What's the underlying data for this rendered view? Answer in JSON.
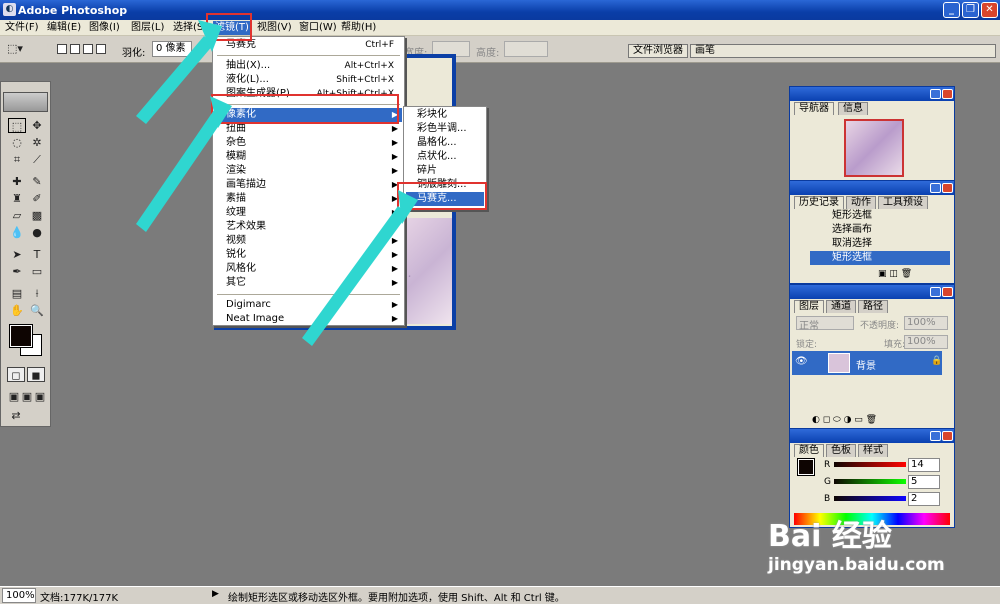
{
  "window": {
    "title": "Adobe Photoshop"
  },
  "menubar": {
    "items": [
      "文件(F)",
      "编辑(E)",
      "图像(I)",
      "图层(L)",
      "选择(S)",
      "滤镜(T)",
      "视图(V)",
      "窗口(W)",
      "帮助(H)"
    ]
  },
  "options": {
    "feather_label": "羽化:",
    "feather_value": "0 像素",
    "width_label": "宽度:",
    "height_label": "高度:",
    "well_tabs": [
      "文件浏览器",
      "画笔"
    ]
  },
  "filter_menu": {
    "last_filter": "马赛克",
    "last_filter_shortcut": "Ctrl+F",
    "items": [
      {
        "label": "抽出(X)...",
        "shortcut": "Alt+Ctrl+X"
      },
      {
        "label": "液化(L)...",
        "shortcut": "Shift+Ctrl+X"
      },
      {
        "label": "图案生成器(P)...",
        "shortcut": "Alt+Shift+Ctrl+X"
      }
    ],
    "submenus": [
      "像素化",
      "扭曲",
      "杂色",
      "模糊",
      "渲染",
      "画笔描边",
      "素描",
      "纹理",
      "艺术效果",
      "视频",
      "锐化",
      "风格化",
      "其它"
    ],
    "plugins": [
      "Digimarc",
      "Neat Image"
    ]
  },
  "pixelate_menu": {
    "items": [
      "彩块化",
      "彩色半调...",
      "晶格化...",
      "点状化...",
      "碎片",
      "铜版雕刻...",
      "马赛克..."
    ]
  },
  "navigator_panel": {
    "tabs": [
      "导航器",
      "信息"
    ]
  },
  "history_panel": {
    "tabs": [
      "历史记录",
      "动作",
      "工具预设"
    ],
    "rows": [
      "矩形选框",
      "选择画布",
      "取消选择",
      "矩形选框"
    ]
  },
  "layers_panel": {
    "tabs": [
      "图层",
      "通道",
      "路径"
    ],
    "blend_mode": "正常",
    "opacity_label": "不透明度:",
    "opacity_value": "100%",
    "lock_label": "锁定:",
    "fill_label": "填充:",
    "fill_value": "100%",
    "layer_name": "背景"
  },
  "color_panel": {
    "tabs": [
      "颜色",
      "色板",
      "样式"
    ],
    "channels": [
      {
        "name": "R",
        "value": "14"
      },
      {
        "name": "G",
        "value": "5"
      },
      {
        "name": "B",
        "value": "2"
      }
    ]
  },
  "status": {
    "zoom": "100%",
    "doc": "文档:177K/177K",
    "hint": "绘制矩形选区或移动选区外框。要用附加选项，使用 Shift、Alt 和 Ctrl 键。"
  },
  "watermark": {
    "brand": "Bai 经验",
    "url": "jingyan.baidu.com"
  },
  "colors": {
    "highlight": "#316ac5",
    "annotation": "#e0332f",
    "arrow": "#2fd6d0"
  }
}
